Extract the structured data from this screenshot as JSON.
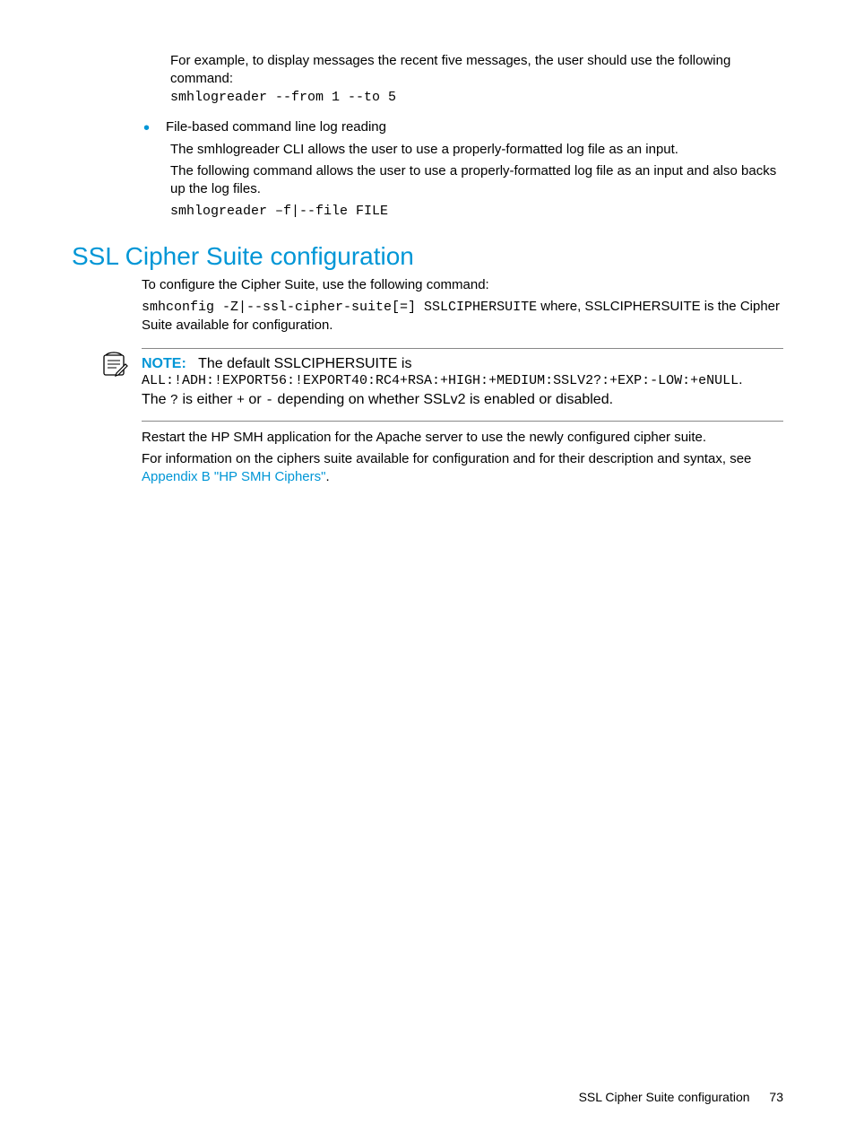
{
  "top": {
    "example_intro": "For example, to display messages the recent five messages, the user should use the following command:",
    "example_cmd": "smhlogreader --from 1 --to 5",
    "bullet_label": "File-based command line log reading",
    "bullet_p1": "The smhlogreader CLI allows the user to use a properly-formatted log file as an input.",
    "bullet_p2": "The following command allows the user to use a properly-formatted log file as an input and also backs up the log files.",
    "bullet_cmd": "smhlogreader –f|--file FILE"
  },
  "section": {
    "title": "SSL Cipher Suite configuration",
    "intro": "To configure the Cipher Suite, use the following command:",
    "cmd_part": "smhconfig -Z|--ssl-cipher-suite[=] SSLCIPHERSUITE",
    "cmd_tail": " where, SSLCIPHERSUITE is the Cipher Suite available for configuration.",
    "note_label": "NOTE:",
    "note_intro": "The default SSLCIPHERSUITE is",
    "note_value": "ALL:!ADH:!EXPORT56:!EXPORT40:RC4+RSA:+HIGH:+MEDIUM:SSLV2?:+EXP:-LOW:+eNULL",
    "note_tail_a": "The ",
    "note_tail_q": "?",
    "note_tail_b": " is either ",
    "note_tail_plus": "+",
    "note_tail_c": " or ",
    "note_tail_minus": "-",
    "note_tail_d": " depending on whether SSLv2 is enabled or disabled.",
    "restart": "Restart the HP SMH application for the Apache server to use the newly configured cipher suite.",
    "info_pre": "For information on the ciphers suite available for configuration and for their description and syntax, see ",
    "info_link": "Appendix B \"HP SMH Ciphers\"",
    "info_post": "."
  },
  "footer": {
    "title": "SSL Cipher Suite configuration",
    "page": "73"
  }
}
